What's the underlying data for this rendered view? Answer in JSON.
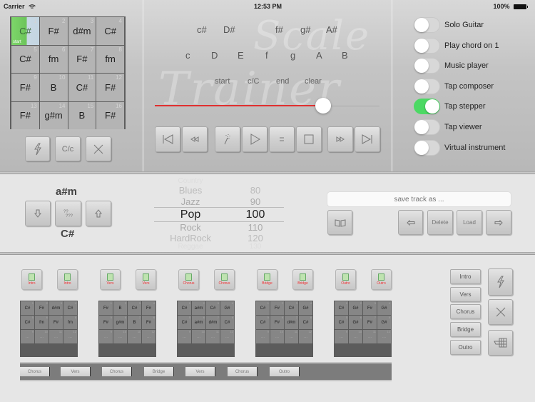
{
  "status_bar": {
    "carrier": "Carrier",
    "time": "12:53 PM",
    "battery": "100%"
  },
  "chord_grid": {
    "cells": [
      {
        "num": "1",
        "chord": "C#",
        "active": true,
        "tag": "start"
      },
      {
        "num": "2",
        "chord": "F#"
      },
      {
        "num": "3",
        "chord": "d#m"
      },
      {
        "num": "4",
        "chord": "C#"
      },
      {
        "num": "5",
        "chord": "C#"
      },
      {
        "num": "6",
        "chord": "fm"
      },
      {
        "num": "7",
        "chord": "F#"
      },
      {
        "num": "8",
        "chord": "fm"
      },
      {
        "num": "9",
        "chord": "F#"
      },
      {
        "num": "10",
        "chord": "B"
      },
      {
        "num": "11",
        "chord": "C#"
      },
      {
        "num": "12",
        "chord": "F#"
      },
      {
        "num": "13",
        "chord": "F#"
      },
      {
        "num": "14",
        "chord": "g#m"
      },
      {
        "num": "15",
        "chord": "B"
      },
      {
        "num": "16",
        "chord": "F#"
      }
    ],
    "buttons": {
      "randomize": "lightning-icon",
      "case": "C/c",
      "clear": "close-icon"
    }
  },
  "scale": {
    "watermark_line1": "Scale",
    "watermark_line2": "Trainer",
    "sharps": [
      "c#",
      "D#",
      "f#",
      "g#",
      "A#"
    ],
    "naturals": [
      "c",
      "D",
      "E",
      "f",
      "g",
      "A",
      "B"
    ],
    "controls": [
      "start",
      "c/C",
      "end",
      "clear"
    ],
    "slider_value_percent": 75
  },
  "transport": [
    "skip-to-start-icon",
    "rewind-icon",
    "magic-wand-icon",
    "play-icon",
    "equals-icon",
    "stop-icon",
    "fast-forward-icon",
    "skip-to-end-icon"
  ],
  "toggles": [
    {
      "label": "Solo Guitar",
      "on": false
    },
    {
      "label": "Play chord on 1",
      "on": false
    },
    {
      "label": "Music player",
      "on": false
    },
    {
      "label": "Tap composer",
      "on": false
    },
    {
      "label": "Tap stepper",
      "on": true
    },
    {
      "label": "Tap viewer",
      "on": false
    },
    {
      "label": "Virtual instrument",
      "on": false
    }
  ],
  "key": {
    "relative_minor": "a#m",
    "major": "C#"
  },
  "picker": {
    "rows": [
      {
        "style": "Country",
        "bpm": ""
      },
      {
        "style": "Blues",
        "bpm": "80"
      },
      {
        "style": "Jazz",
        "bpm": "90"
      },
      {
        "style": "Pop",
        "bpm": "100",
        "selected": true
      },
      {
        "style": "Rock",
        "bpm": "110"
      },
      {
        "style": "HardRock",
        "bpm": "120"
      },
      {
        "style": "Reggae",
        "bpm": "130"
      }
    ]
  },
  "track": {
    "placeholder": "save track as ...",
    "value": "",
    "delete": "Delete",
    "load": "Load"
  },
  "parts": [
    {
      "name": "Intro",
      "label_a": "Intro",
      "label_b": "Intro",
      "cells": [
        "C#",
        "F#",
        "d#m",
        "C#",
        "C#",
        "fm",
        "F#",
        "fm",
        "...",
        "...",
        "...",
        "..."
      ]
    },
    {
      "name": "Vers",
      "label_a": "Vers",
      "label_b": "Vers",
      "cells": [
        "F#",
        "B",
        "C#",
        "F#",
        "F#",
        "g#m",
        "B",
        "F#",
        "...",
        "...",
        "...",
        "..."
      ]
    },
    {
      "name": "Chorus",
      "label_a": "Chorus",
      "label_b": "Chorus",
      "cells": [
        "C#",
        "a#m",
        "C#",
        "G#",
        "C#",
        "a#m",
        "d#m",
        "C#",
        "...",
        "...",
        "...",
        "..."
      ]
    },
    {
      "name": "Bridge",
      "label_a": "Bridge",
      "label_b": "Bridge",
      "cells": [
        "C#",
        "F#",
        "C#",
        "G#",
        "C#",
        "F#",
        "d#m",
        "C#",
        "...",
        "...",
        "...",
        "..."
      ]
    },
    {
      "name": "Outro",
      "label_a": "Outro",
      "label_b": "Outro",
      "cells": [
        "C#",
        "G#",
        "F#",
        "G#",
        "C#",
        "G#",
        "F#",
        "G#",
        "...",
        "...",
        "...",
        "..."
      ]
    }
  ],
  "sequence": [
    "Chorus",
    "Vers",
    "Chorus",
    "Bridge",
    "Vers",
    "Chorus",
    "Outro"
  ],
  "side_parts": [
    "Intro",
    "Vers",
    "Chorus",
    "Bridge",
    "Outro"
  ],
  "colors": {
    "accent_green": "#4cd964",
    "slider_red": "#e03030",
    "part_label_red": "#e33333"
  }
}
